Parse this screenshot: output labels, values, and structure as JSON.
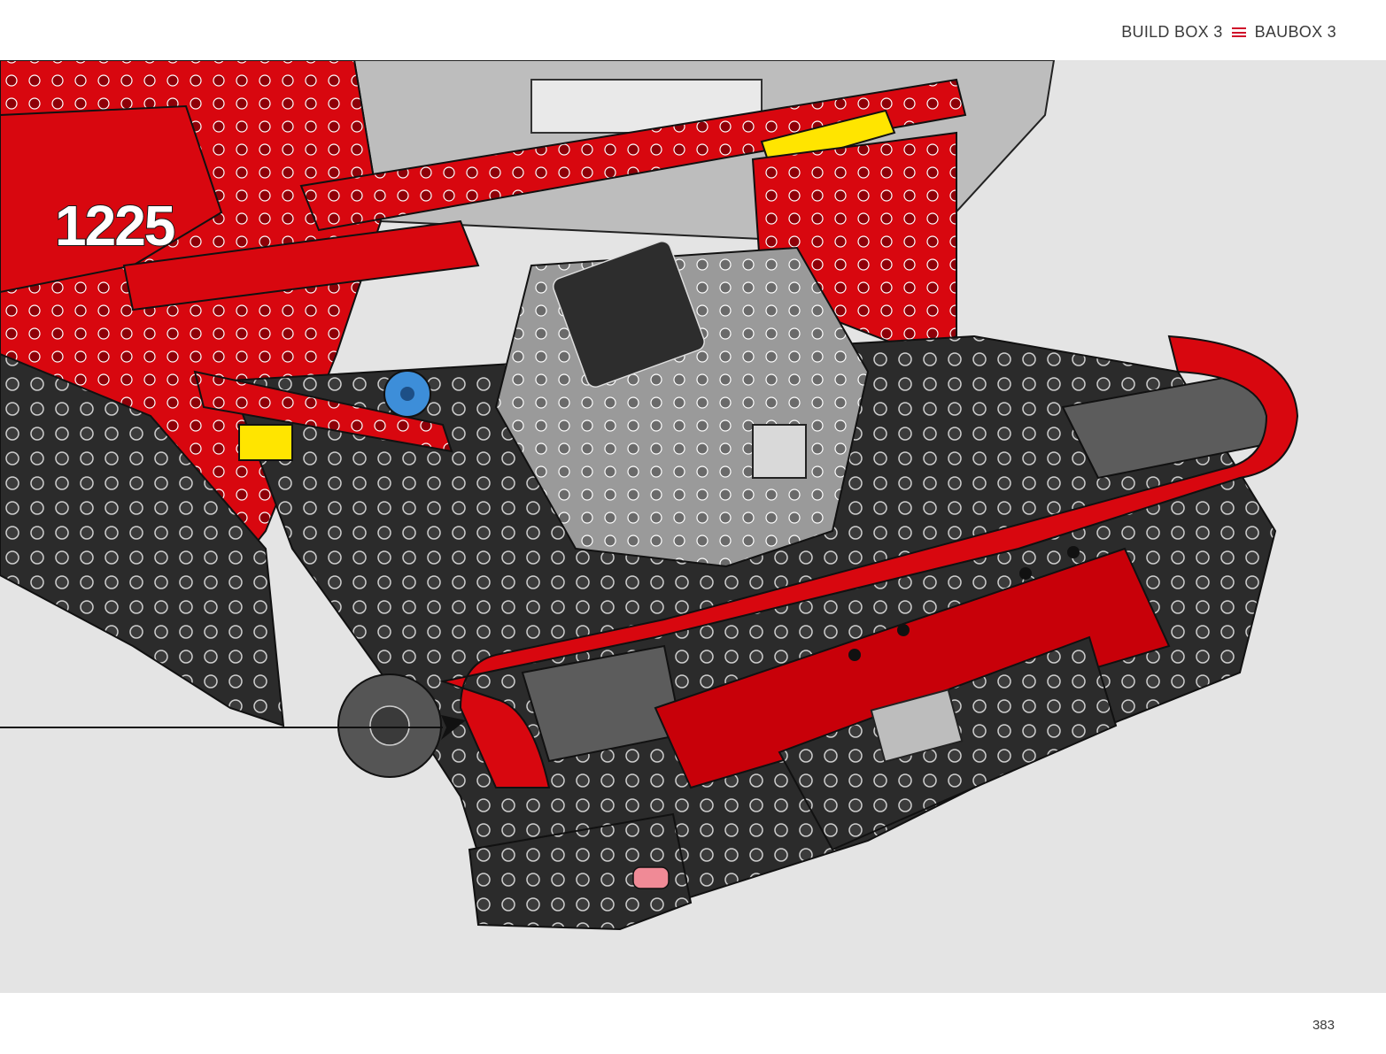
{
  "header": {
    "left_label": "BUILD BOX 3",
    "right_label": "BAUBOX 3",
    "separator_icon": "triple-line-icon",
    "accent_color": "#d0102a"
  },
  "step": {
    "number": "1225"
  },
  "footer": {
    "page_number": "383"
  },
  "illustration": {
    "subject": "rear-chassis-assembly",
    "colors": {
      "body_red": "#d8070f",
      "frame_dark": "#2d2d2d",
      "grey": "#8e8e8e",
      "light_grey": "#bfbfbf",
      "accent_yellow": "#ffe500",
      "accent_blue": "#1f6fc8"
    }
  }
}
